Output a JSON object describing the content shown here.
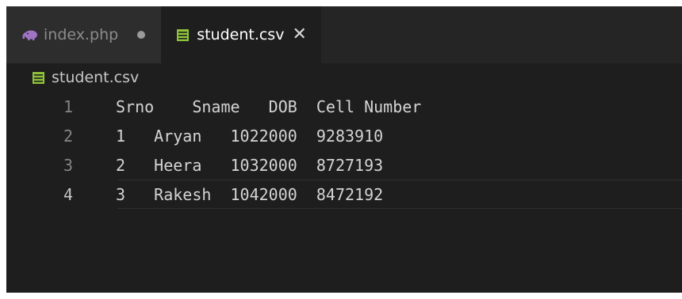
{
  "tabs": [
    {
      "label": "index.php",
      "icon": "php-elephant-icon",
      "modified": true,
      "active": false
    },
    {
      "label": "student.csv",
      "icon": "csv-table-icon",
      "active": true,
      "close_glyph": "✕"
    }
  ],
  "breadcrumb": {
    "label": "student.csv",
    "icon": "csv-table-icon"
  },
  "editor": {
    "lines": [
      {
        "number": "1",
        "text": "Srno    Sname   DOB  Cell Number"
      },
      {
        "number": "2",
        "text": "1   Aryan   1022000  9283910"
      },
      {
        "number": "3",
        "text": "2   Heera   1032000  8727193"
      },
      {
        "number": "4",
        "text": "3   Rakesh  1042000  8472192"
      }
    ],
    "current_line": 4
  },
  "colors": {
    "editor_bg": "#1e1e1e",
    "tabbar_bg": "#252526",
    "csv_icon": "#8fc43a",
    "php_icon": "#a074c4"
  }
}
